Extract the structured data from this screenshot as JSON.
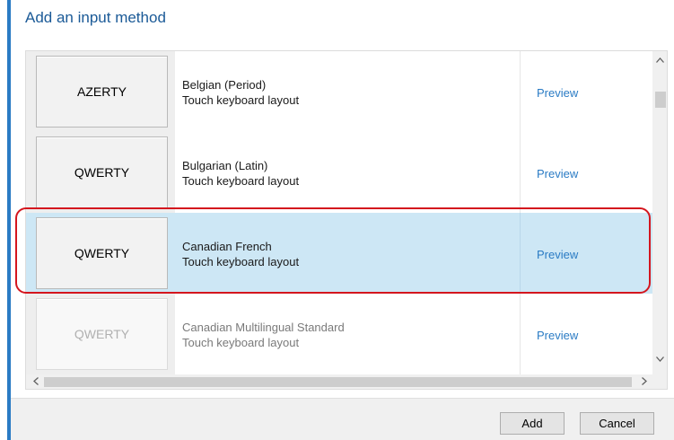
{
  "dialog": {
    "title": "Add an input method"
  },
  "layouts": [
    {
      "key_label": "AZERTY",
      "name": "Belgian (Period)",
      "type": "Touch keyboard layout",
      "action": "Preview",
      "selected": false
    },
    {
      "key_label": "QWERTY",
      "name": "Bulgarian (Latin)",
      "type": "Touch keyboard layout",
      "action": "Preview",
      "selected": false
    },
    {
      "key_label": "QWERTY",
      "name": "Canadian French",
      "type": "Touch keyboard layout",
      "action": "Preview",
      "selected": true
    },
    {
      "key_label": "QWERTY",
      "name": "Canadian Multilingual Standard",
      "type": "Touch keyboard layout",
      "action": "Preview",
      "selected": false
    }
  ],
  "scrollbars": {
    "up_icon": "chevron-up-icon",
    "down_icon": "chevron-down-icon",
    "left_icon": "chevron-left-icon",
    "right_icon": "chevron-right-icon"
  },
  "footer": {
    "add_label": "Add",
    "cancel_label": "Cancel"
  },
  "colors": {
    "accent": "#2a7bc4",
    "selection": "#cde7f5",
    "highlight_ring": "#d4161e"
  }
}
